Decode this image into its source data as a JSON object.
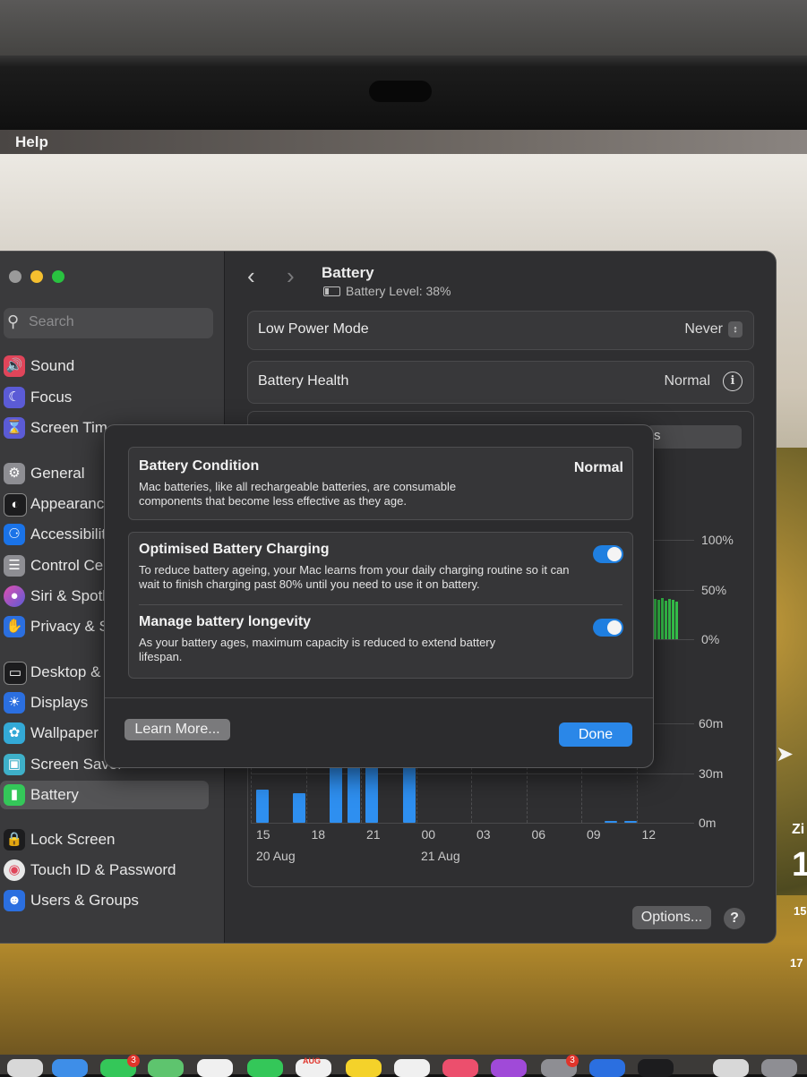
{
  "menubar": {
    "help_label": "Help"
  },
  "search": {
    "placeholder": "Search"
  },
  "sidebar": {
    "items": [
      {
        "label": "Sound",
        "icon": "speaker-icon",
        "color": "#e0455a"
      },
      {
        "label": "Focus",
        "icon": "moon-icon",
        "color": "#5b5bd6"
      },
      {
        "label": "Screen Tim",
        "icon": "hourglass-icon",
        "color": "#5b5bd6"
      },
      {
        "label": "General",
        "icon": "gear-icon",
        "color": "#8e8e93"
      },
      {
        "label": "Appearanc",
        "icon": "appearance-icon",
        "color": "#1c1c1e"
      },
      {
        "label": "Accessibilit",
        "icon": "accessibility-icon",
        "color": "#1a73e8"
      },
      {
        "label": "Control Cer",
        "icon": "control-center-icon",
        "color": "#8e8e93"
      },
      {
        "label": "Siri & Spotl",
        "icon": "siri-icon",
        "color": "#b14ad8"
      },
      {
        "label": "Privacy & S",
        "icon": "hand-icon",
        "color": "#2b6fe0"
      },
      {
        "label": "Desktop &",
        "icon": "desktop-icon",
        "color": "#1c1c1e"
      },
      {
        "label": "Displays",
        "icon": "sun-icon",
        "color": "#2b6fe0"
      },
      {
        "label": "Wallpaper",
        "icon": "flower-icon",
        "color": "#33a9d6"
      },
      {
        "label": "Screen Saver",
        "icon": "screensaver-icon",
        "color": "#3eb0c9"
      },
      {
        "label": "Battery",
        "icon": "battery-icon",
        "color": "#34c759"
      },
      {
        "label": "Lock Screen",
        "icon": "lock-icon",
        "color": "#1c1c1e"
      },
      {
        "label": "Touch ID & Password",
        "icon": "fingerprint-icon",
        "color": "#e8e8e8"
      },
      {
        "label": "Users & Groups",
        "icon": "users-icon",
        "color": "#2b6fe0"
      }
    ]
  },
  "header": {
    "title": "Battery",
    "subtitle": "Battery Level: 38%"
  },
  "low_power": {
    "label": "Low Power Mode",
    "value": "Never"
  },
  "battery_health": {
    "label": "Battery Health",
    "value": "Normal"
  },
  "hidden_row_fragment": "s",
  "chart_data": [
    {
      "type": "bar",
      "title": "",
      "ytick_labels": [
        "100%",
        "50%",
        "0%"
      ],
      "ylim": [
        0,
        100
      ],
      "visible_bar_values": [
        96,
        94,
        98,
        92,
        96,
        94,
        90
      ],
      "color": "#35c04a"
    },
    {
      "type": "bar",
      "title": "",
      "xtick_labels": [
        "15",
        "18",
        "21",
        "00",
        "03",
        "06",
        "09",
        "12"
      ],
      "date_labels": [
        "20 Aug",
        "21 Aug"
      ],
      "ytick_labels": [
        "60m",
        "30m",
        "0m"
      ],
      "ylim": [
        0,
        60
      ],
      "values": [
        20,
        18,
        55,
        55,
        55,
        55,
        1,
        1
      ],
      "color": "#2e8ff0"
    }
  ],
  "dialog": {
    "condition_title": "Battery Condition",
    "condition_value": "Normal",
    "condition_desc": "Mac batteries, like all rechargeable batteries, are consumable components that become less effective as they age.",
    "optimised_title": "Optimised Battery Charging",
    "optimised_desc": "To reduce battery ageing, your Mac learns from your daily charging routine so it can wait to finish charging past 80% until you need to use it on battery.",
    "optimised_on": true,
    "longevity_title": "Manage battery longevity",
    "longevity_desc": "As your battery ages, maximum capacity is reduced to extend battery lifespan.",
    "longevity_on": true,
    "learn_more": "Learn More...",
    "done": "Done"
  },
  "footer": {
    "options": "Options...",
    "help": "?"
  },
  "partial_right_text": {
    "a": "Zi",
    "b": "1",
    "c": "15",
    "d": "17"
  },
  "dock_badges": {
    "badge_a": "3",
    "badge_b": "AUG",
    "badge_c": "3"
  }
}
